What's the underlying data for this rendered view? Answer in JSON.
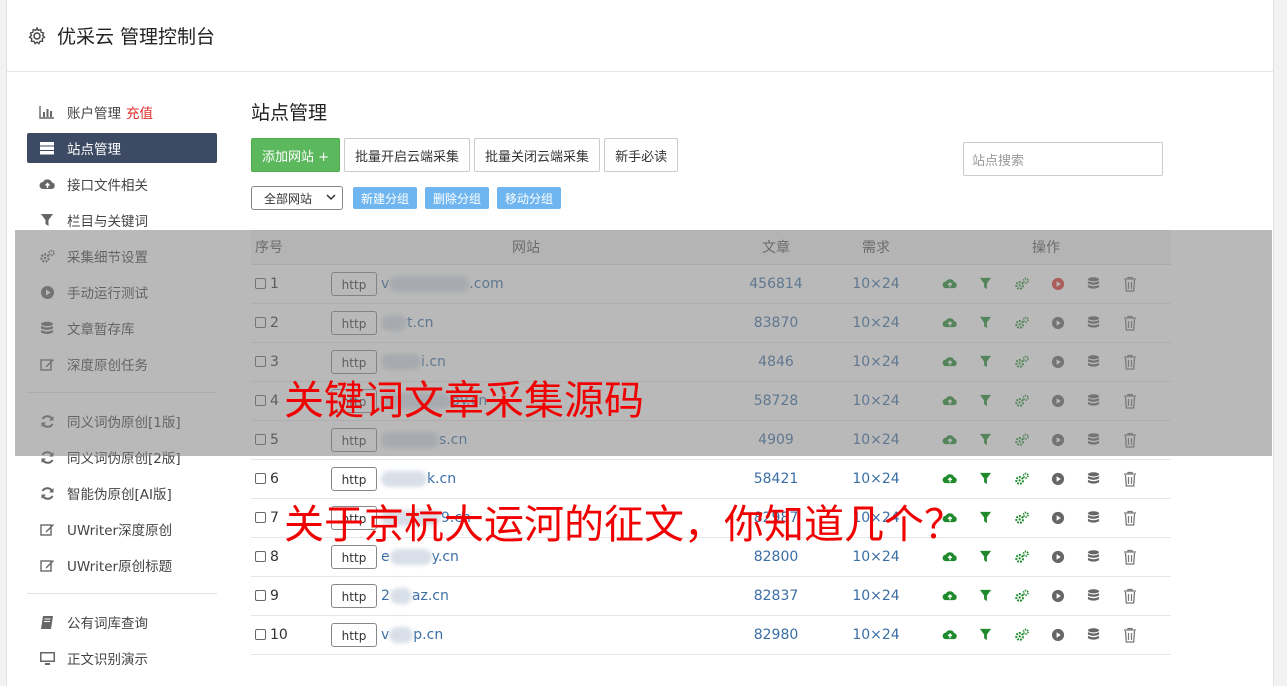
{
  "app": {
    "title": "优采云 管理控制台"
  },
  "sidebar": {
    "items": [
      {
        "label": "账户管理",
        "extra": "充值",
        "icon": "bar-chart-icon"
      },
      {
        "label": "站点管理",
        "icon": "server-icon",
        "active": true
      },
      {
        "label": "接口文件相关",
        "icon": "cloud-upload-icon"
      },
      {
        "label": "栏目与关键词",
        "icon": "filter-icon"
      },
      {
        "label": "采集细节设置",
        "icon": "gears-icon"
      },
      {
        "label": "手动运行测试",
        "icon": "play-circle-icon"
      },
      {
        "label": "文章暂存库",
        "icon": "database-icon"
      },
      {
        "label": "深度原创任务",
        "icon": "edit-icon"
      }
    ],
    "group2": [
      {
        "label": "同义词伪原创[1版]",
        "icon": "refresh-icon"
      },
      {
        "label": "同义词伪原创[2版]",
        "icon": "refresh-icon"
      },
      {
        "label": "智能伪原创[AI版]",
        "icon": "refresh-icon"
      },
      {
        "label": "UWriter深度原创",
        "icon": "edit-icon"
      },
      {
        "label": "UWriter原创标题",
        "icon": "edit-icon"
      }
    ],
    "group3": [
      {
        "label": "公有词库查询",
        "icon": "book-icon"
      },
      {
        "label": "正文识别演示",
        "icon": "monitor-icon"
      }
    ]
  },
  "main": {
    "title": "站点管理",
    "add_site": "添加网站 +",
    "batch_open": "批量开启云端采集",
    "batch_close": "批量关闭云端采集",
    "newbie": "新手必读",
    "search_placeholder": "站点搜索",
    "group_select": "全部网站",
    "new_group": "新建分组",
    "delete_group": "删除分组",
    "move_group": "移动分组",
    "columns": {
      "no": "序号",
      "site": "网站",
      "articles": "文章",
      "demand": "需求",
      "ops": "操作"
    },
    "rows": [
      {
        "no": "1",
        "proto": "http",
        "prefix": "v",
        "suffix": ".com",
        "articles": "456814",
        "demand": "10×24",
        "running": true
      },
      {
        "no": "2",
        "proto": "http",
        "prefix": "",
        "suffix": "t.cn",
        "articles": "83870",
        "demand": "10×24",
        "running": false
      },
      {
        "no": "3",
        "proto": "http",
        "prefix": "",
        "suffix": "i.cn",
        "articles": "4846",
        "demand": "10×24",
        "running": false
      },
      {
        "no": "4",
        "proto": "http",
        "prefix": "",
        "suffix": "py.cn",
        "articles": "58728",
        "demand": "10×24",
        "running": false
      },
      {
        "no": "5",
        "proto": "http",
        "prefix": "",
        "suffix": "s.cn",
        "articles": "4909",
        "demand": "10×24",
        "running": false
      },
      {
        "no": "6",
        "proto": "http",
        "prefix": "",
        "suffix": "k.cn",
        "articles": "58421",
        "demand": "10×24",
        "running": false
      },
      {
        "no": "7",
        "proto": "http",
        "prefix": "",
        "suffix": "9.cn",
        "articles": "82987",
        "demand": "10×24",
        "running": false
      },
      {
        "no": "8",
        "proto": "http",
        "prefix": "e",
        "suffix": "y.cn",
        "articles": "82800",
        "demand": "10×24",
        "running": false
      },
      {
        "no": "9",
        "proto": "http",
        "prefix": "2",
        "suffix": "az.cn",
        "articles": "82837",
        "demand": "10×24",
        "running": false
      },
      {
        "no": "10",
        "proto": "http",
        "prefix": "v",
        "suffix": "p.cn",
        "articles": "82980",
        "demand": "10×24",
        "running": false
      }
    ]
  },
  "overlay": {
    "line1": "关键词文章采集源码",
    "line2": "关于京杭大运河的征文，你知道几个？"
  },
  "colors": {
    "accent": "#5cb85c",
    "active_nav": "#3d4a63",
    "link": "#3a6ea5",
    "overlay_text": "#f00000",
    "play_active": "#e0332d"
  }
}
